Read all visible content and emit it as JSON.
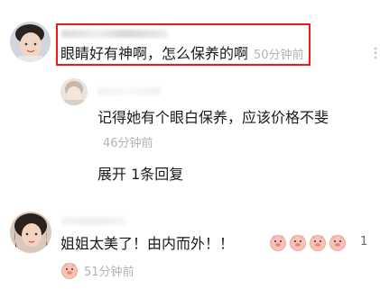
{
  "comment1": {
    "text": "眼睛好有神啊，怎么保养的啊",
    "time": "50分钟前"
  },
  "reply": {
    "text": "记得她有个眼白保养，应该价格不斐",
    "time": "46分钟前",
    "expand_label": "展开 1条回复"
  },
  "comment2": {
    "text": "姐姐太美了！由内而外！！",
    "time": "51分钟前",
    "like_count": "1"
  },
  "colors": {
    "highlight": "#f01818",
    "time_gray": "#b3b3b3"
  }
}
